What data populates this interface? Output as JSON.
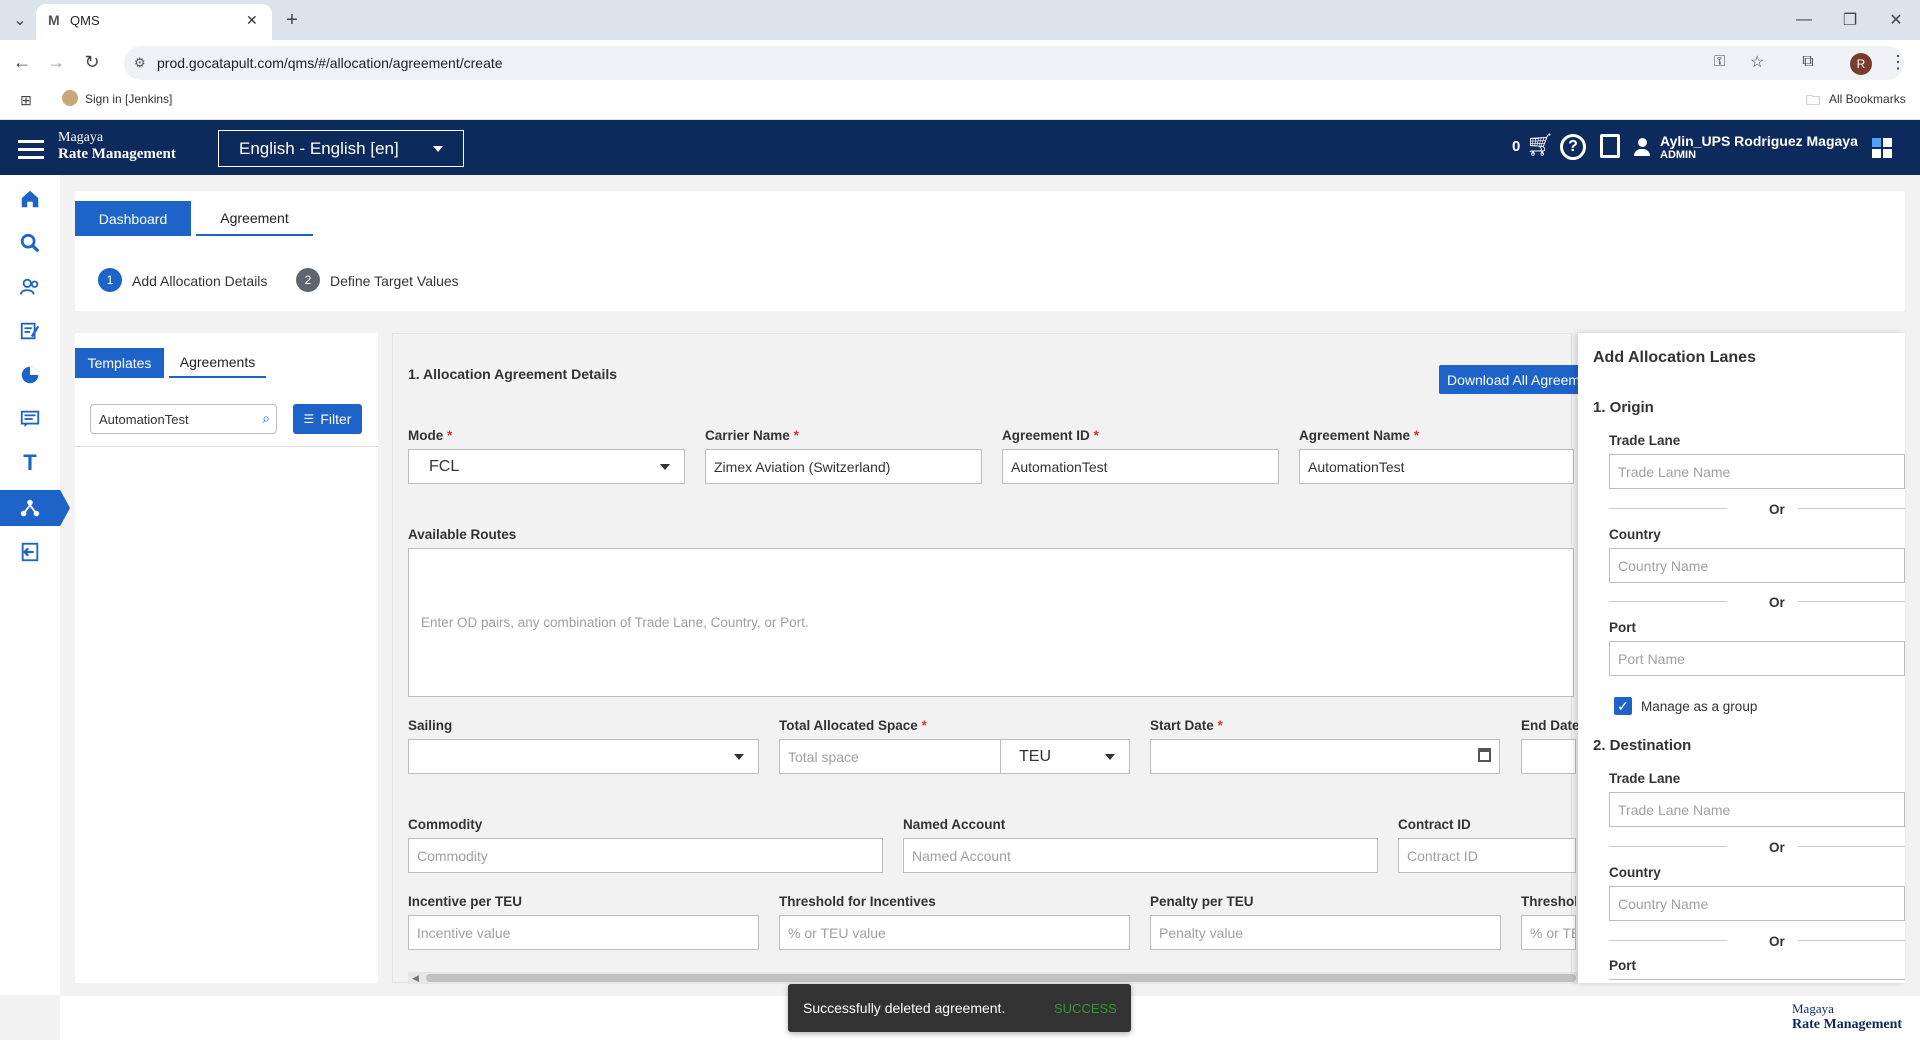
{
  "browser": {
    "tab_title": "QMS",
    "url": "prod.gocatapult.com/qms/#/allocation/agreement/create",
    "bookmark": "Sign in [Jenkins]",
    "all_bookmarks": "All Bookmarks",
    "profile_initial": "R"
  },
  "header": {
    "brand_line1": "Magaya",
    "brand_line2": "Rate Management",
    "language": "English - English [en]",
    "cart_count": "0",
    "user_name": "Aylin_UPS Rodriguez Magaya",
    "user_role": "ADMIN"
  },
  "tabs": {
    "dashboard": "Dashboard",
    "agreement": "Agreement"
  },
  "steps": [
    {
      "num": "1",
      "label": "Add Allocation Details"
    },
    {
      "num": "2",
      "label": "Define Target Values"
    }
  ],
  "left_panel": {
    "tab_templates": "Templates",
    "tab_agreements": "Agreements",
    "search_value": "AutomationTest",
    "filter_label": "Filter"
  },
  "form": {
    "section_title": "1. Allocation Agreement Details",
    "download_button": "Download All Agreem",
    "mode_label": "Mode",
    "mode_value": "FCL",
    "carrier_label": "Carrier Name",
    "carrier_value": "Zimex Aviation (Switzerland)",
    "agreement_id_label": "Agreement ID",
    "agreement_id_value": "AutomationTest",
    "agreement_name_label": "Agreement Name",
    "agreement_name_value": "AutomationTest",
    "routes_label": "Available Routes",
    "routes_placeholder": "Enter OD pairs, any combination of Trade Lane, Country, or Port.",
    "sailing_label": "Sailing",
    "total_space_label": "Total Allocated Space",
    "total_space_placeholder": "Total space",
    "unit_value": "TEU",
    "start_date_label": "Start Date",
    "end_date_label": "End Date",
    "commodity_label": "Commodity",
    "commodity_placeholder": "Commodity",
    "named_account_label": "Named Account",
    "named_account_placeholder": "Named Account",
    "contract_id_label": "Contract ID",
    "contract_id_placeholder": "Contract ID",
    "incentive_label": "Incentive per TEU",
    "incentive_placeholder": "Incentive value",
    "threshold_inc_label": "Threshold for Incentives",
    "threshold_inc_placeholder": "% or TEU value",
    "penalty_label": "Penalty per TEU",
    "penalty_placeholder": "Penalty value",
    "threshold_pen_label": "Threshol",
    "threshold_pen_placeholder": "% or TE"
  },
  "lanes": {
    "title": "Add Allocation Lanes",
    "origin_title": "1. Origin",
    "destination_title": "2. Destination",
    "trade_lane_label": "Trade Lane",
    "trade_lane_placeholder": "Trade Lane Name",
    "or": "Or",
    "country_label": "Country",
    "country_placeholder": "Country Name",
    "port_label": "Port",
    "port_placeholder": "Port Name",
    "manage_group": "Manage as a group"
  },
  "toast": {
    "message": "Successfully deleted agreement.",
    "status": "SUCCESS"
  },
  "footer": {
    "brand_line1": "Magaya",
    "brand_line2": "Rate Management"
  },
  "colors": {
    "header_navy": "#0d2a5c",
    "primary_blue": "#1d63c8",
    "required_red": "#d9303b",
    "success_green": "#2e9b2e"
  }
}
